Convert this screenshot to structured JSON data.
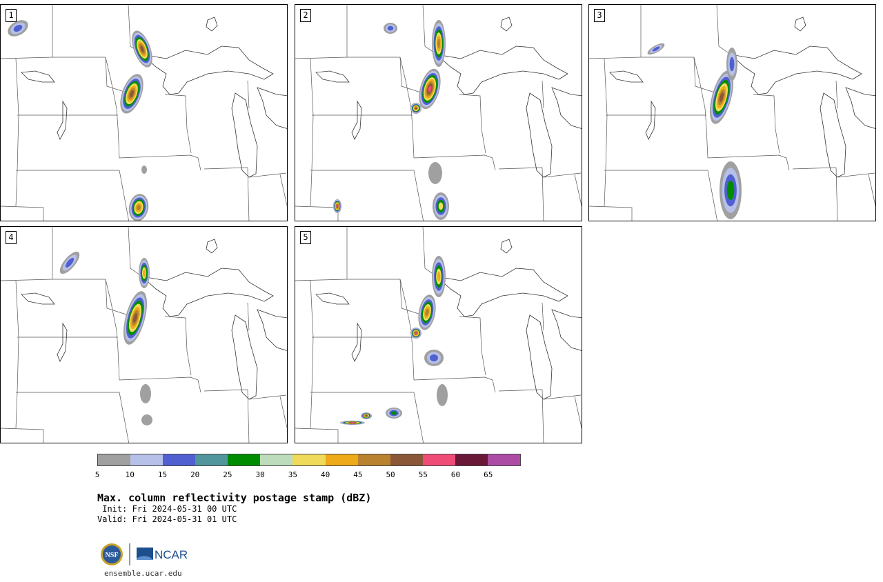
{
  "panels": [
    {
      "label": "1"
    },
    {
      "label": "2"
    },
    {
      "label": "3"
    },
    {
      "label": "4"
    },
    {
      "label": "5"
    }
  ],
  "colorbar": {
    "colors": [
      "#a0a0a0",
      "#b6c0e8",
      "#5060d0",
      "#50969c",
      "#008c00",
      "#bcdcbc",
      "#f0da5a",
      "#eeaa18",
      "#b8822e",
      "#8a5838",
      "#f04c78",
      "#6a1838",
      "#ac4ca4"
    ],
    "ticks": [
      "5",
      "10",
      "15",
      "20",
      "25",
      "30",
      "35",
      "40",
      "45",
      "50",
      "55",
      "60",
      "65"
    ]
  },
  "title": "Max. column reflectivity postage stamp (dBZ)",
  "init": " Init: Fri 2024-05-31 00 UTC",
  "valid": "Valid: Fri 2024-05-31 01 UTC",
  "logo": {
    "nsf_text": "NSF",
    "ncar_text": "NCAR"
  },
  "url": "ensemble.ucar.edu"
}
